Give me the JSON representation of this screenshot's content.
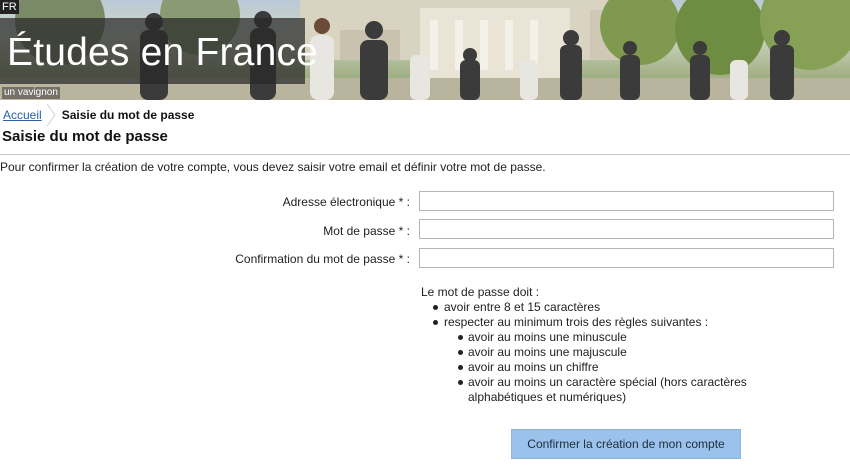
{
  "header": {
    "lang": "FR",
    "site_title": "Études en France",
    "photo_credit": "un vavignon"
  },
  "breadcrumb": {
    "home": "Accueil",
    "current": "Saisie du mot de passe"
  },
  "page": {
    "title": "Saisie du mot de passe",
    "intro": "Pour confirmer la création de votre compte, vous devez saisir votre email et définir votre mot de passe."
  },
  "form": {
    "email_label": "Adresse électronique * :",
    "email_value": "",
    "password_label": "Mot de passe * :",
    "password_value": "",
    "confirm_label": "Confirmation du mot de passe * :",
    "confirm_value": ""
  },
  "rules": {
    "heading": "Le mot de passe doit :",
    "items": [
      "avoir entre 8 et 15 caractères",
      "respecter au minimum trois des règles suivantes :"
    ],
    "sub_items": [
      "avoir au moins une minuscule",
      "avoir au moins une majuscule",
      "avoir au moins un chiffre",
      "avoir au moins un caractère spécial (hors caractères",
      "alphabétiques et numériques)"
    ]
  },
  "actions": {
    "submit_label": "Confirmer la création de mon compte"
  }
}
